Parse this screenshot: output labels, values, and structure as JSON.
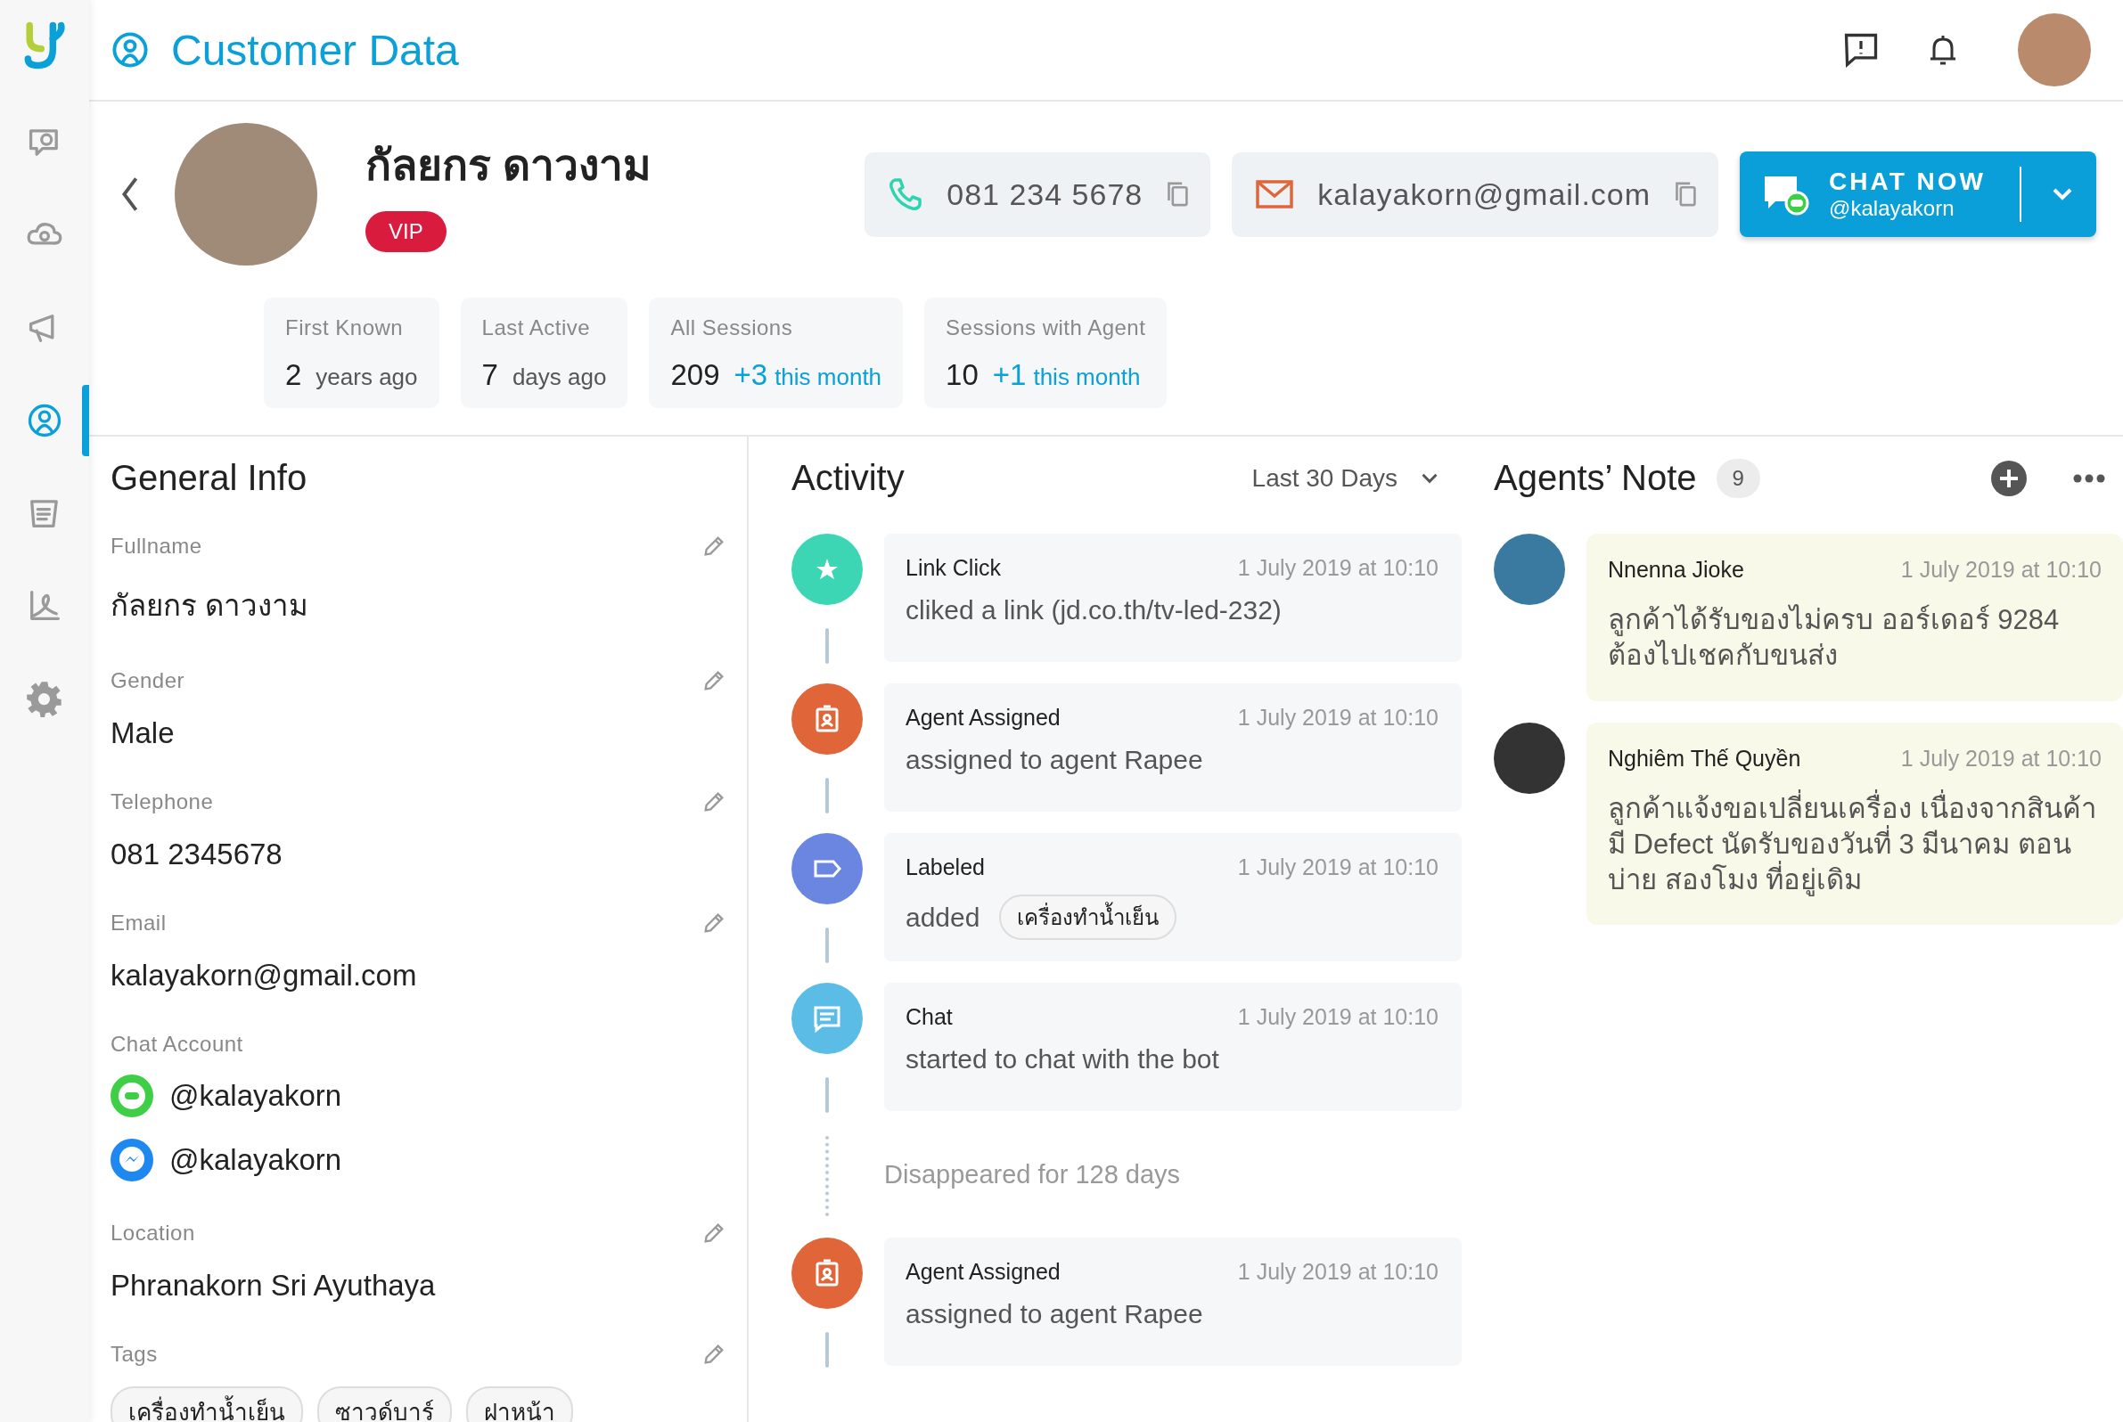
{
  "sidebar": {
    "items": [
      {
        "kind": "chat",
        "selected": false
      },
      {
        "kind": "cloud",
        "selected": false
      },
      {
        "kind": "megaphone",
        "selected": false
      },
      {
        "kind": "customer",
        "selected": true
      },
      {
        "kind": "report",
        "selected": false
      },
      {
        "kind": "chart",
        "selected": false
      },
      {
        "kind": "settings",
        "selected": false
      }
    ]
  },
  "header": {
    "title": "Customer Data"
  },
  "profile": {
    "name": "กัลยกร ดาวงาม",
    "badge": "VIP",
    "phone": "081 234 5678",
    "email": "kalayakorn@gmail.com",
    "chat_button": {
      "label": "CHAT NOW",
      "account": "@kalayakorn"
    }
  },
  "stats": [
    {
      "label": "First Known",
      "value": "2",
      "unit": "years ago"
    },
    {
      "label": "Last Active",
      "value": "7",
      "unit": "days ago"
    },
    {
      "label": "All Sessions",
      "value": "209",
      "delta": "+3",
      "unit": "this month"
    },
    {
      "label": "Sessions with Agent",
      "value": "10",
      "delta": "+1",
      "unit": "this month"
    }
  ],
  "general_info": {
    "title": "General Info",
    "fields": [
      {
        "kind": "text",
        "label": "Fullname",
        "value": "กัลยกร ดาวงาม"
      },
      {
        "kind": "text",
        "label": "Gender",
        "value": "Male"
      },
      {
        "kind": "text",
        "label": "Telephone",
        "value": "081 2345678"
      },
      {
        "kind": "text",
        "label": "Email",
        "value": "kalayakorn@gmail.com"
      },
      {
        "kind": "accounts",
        "label": "Chat Account",
        "accounts": [
          {
            "kind": "line",
            "handle": "@kalayakorn"
          },
          {
            "kind": "messenger",
            "handle": "@kalayakorn"
          }
        ]
      },
      {
        "kind": "text",
        "label": "Location",
        "value": "Phranakorn Sri Ayuthaya"
      },
      {
        "kind": "tags",
        "label": "Tags",
        "tags": [
          "เครื่องทำน้ำเย็น",
          "ซาวด์บาร์",
          "ฝาหน้า"
        ]
      }
    ]
  },
  "activity": {
    "title": "Activity",
    "filter": "Last 30 Days",
    "items": [
      {
        "kind": "link_click",
        "color": "#3dd6b5",
        "title": "Link Click",
        "time": "1 July 2019 at 10:10",
        "text": "cliked a link (jd.co.th/tv-led-232)"
      },
      {
        "kind": "agent_assigned",
        "color": "#e0663a",
        "title": "Agent Assigned",
        "time": "1 July 2019 at 10:10",
        "text": "assigned to agent Rapee"
      },
      {
        "kind": "labeled",
        "color": "#6b86e0",
        "title": "Labeled",
        "time": "1 July 2019 at 10:10",
        "text": "added",
        "tag": "เครื่องทำน้ำเย็น"
      },
      {
        "kind": "chat",
        "color": "#5bbde6",
        "title": "Chat",
        "time": "1 July 2019 at 10:10",
        "text": "started to chat with the bot"
      },
      {
        "kind": "gap",
        "text": "Disappeared for 128 days"
      },
      {
        "kind": "agent_assigned",
        "color": "#e0663a",
        "title": "Agent Assigned",
        "time": "1 July 2019 at 10:10",
        "text": "assigned to agent Rapee"
      }
    ]
  },
  "notes": {
    "title": "Agents’ Note",
    "count": "9",
    "items": [
      {
        "author": "Nnenna Jioke",
        "time": "1 July 2019 at 10:10",
        "text": "ลูกค้าได้รับของไม่ครบ ออร์เดอร์ 9284 ต้องไปเชคกับขนส่ง"
      },
      {
        "author": "Nghiêm Thế Quyền",
        "time": "1 July 2019 at 10:10",
        "text": "ลูกค้าแจ้งขอเปลี่ยนเครื่อง เนื่องจากสินค้ามี Defect นัดรับของวันที่ 3 มีนาคม ตอนบ่าย สองโมง ที่อยู่เดิม"
      }
    ]
  }
}
